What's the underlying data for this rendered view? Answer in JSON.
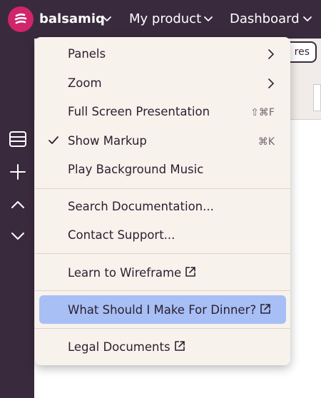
{
  "header": {
    "brand": "balsamiq",
    "product": "My product",
    "dashboard": "Dashboard"
  },
  "toolbar": {
    "partial_button": "res"
  },
  "menu": {
    "panels": "Panels",
    "zoom": "Zoom",
    "full_screen": "Full Screen Presentation",
    "full_screen_shortcut": "⇧⌘F",
    "show_markup": "Show Markup",
    "show_markup_shortcut": "⌘K",
    "play_music": "Play Background Music",
    "search_docs": "Search Documentation...",
    "contact_support": "Contact Support...",
    "learn_wireframe": "Learn to Wireframe",
    "dinner": "What Should I Make For Dinner?",
    "legal": "Legal Documents"
  },
  "colors": {
    "chrome": "#3a2a3d",
    "brand_logo": "#d0256a",
    "menu_bg": "#f8f2ed",
    "highlight": "#a7bff5"
  },
  "icons": {
    "logo": "balsamiq-logo-icon",
    "chevron": "chevron-down-icon",
    "submenu": "chevron-right-icon",
    "check": "checkmark-icon",
    "external": "external-link-icon",
    "sidebar": [
      "panels-icon",
      "plus-icon",
      "chevron-up-icon",
      "chevron-down-icon"
    ]
  }
}
